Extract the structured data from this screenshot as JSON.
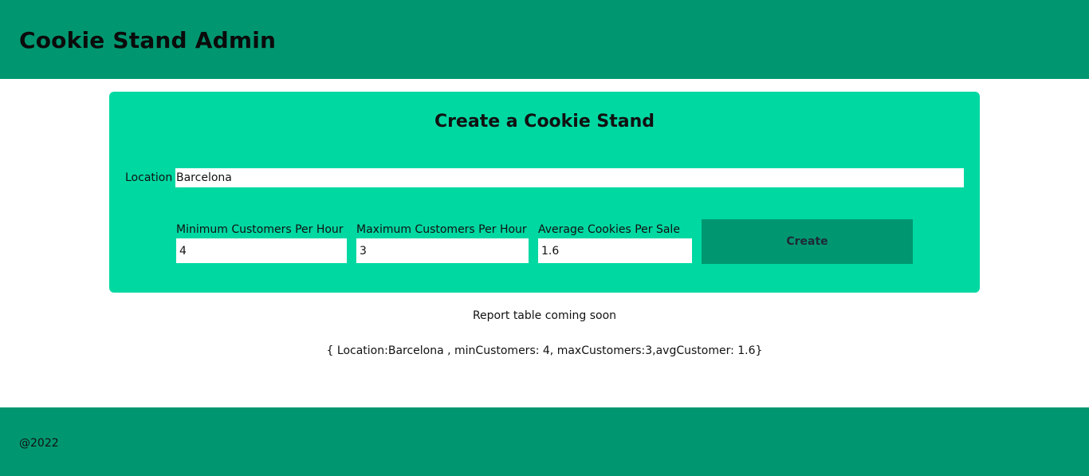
{
  "header": {
    "title": "Cookie Stand Admin"
  },
  "form": {
    "title": "Create a Cookie Stand",
    "location_label": "Location",
    "location_value": "Barcelona",
    "min_label": "Minimum Customers Per Hour",
    "min_value": "4",
    "max_label": "Maximum Customers Per Hour",
    "max_value": "3",
    "avg_label": "Average Cookies Per Sale",
    "avg_value": "1.6",
    "create_label": "Create"
  },
  "main": {
    "report_text": "Report table coming soon",
    "json_text": "{ Location:Barcelona , minCustomers: 4, maxCustomers:3,avgCustomer: 1.6}"
  },
  "footer": {
    "text": "@2022"
  },
  "colors": {
    "header_bg": "#009770",
    "form_bg": "#00d8a2",
    "button_bg": "#009770",
    "footer_bg": "#009770"
  }
}
